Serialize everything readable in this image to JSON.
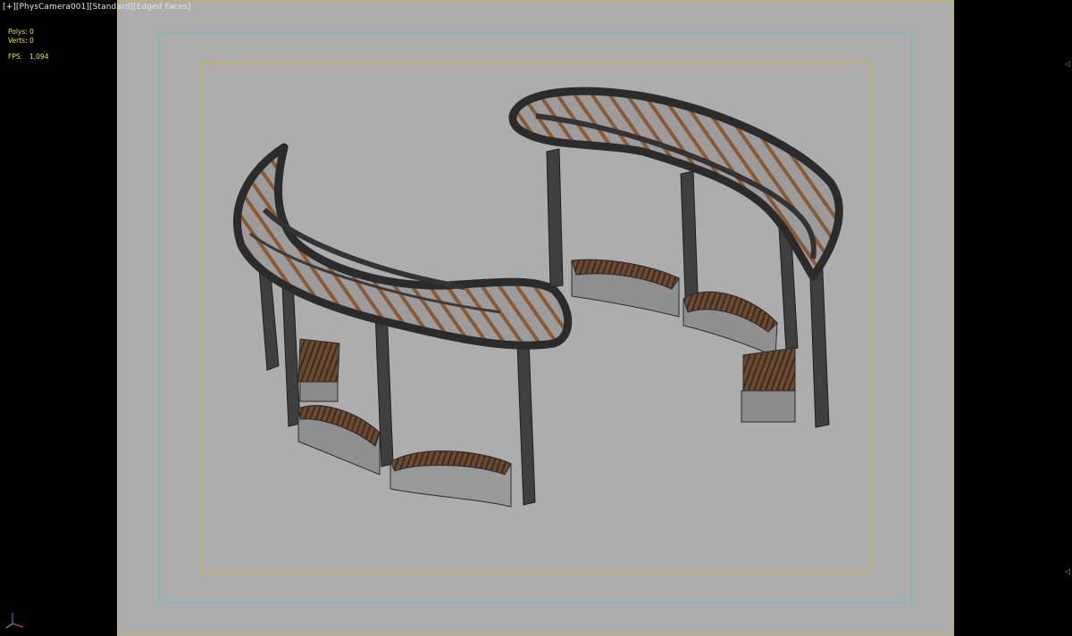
{
  "viewport": {
    "label_parts": [
      "[+]",
      "[PhysCamera001]",
      "[Standard]",
      "[Edged Faces]"
    ]
  },
  "stats": {
    "polys_label": "Polys:",
    "polys_value": "0",
    "verts_label": "Verts:",
    "verts_value": "0",
    "fps_label": "FPS:",
    "fps_value": "1,094"
  },
  "icons": {
    "axis": "axis-tripod-icon",
    "right_marker": "triangle-left-icon"
  },
  "colors": {
    "viewport_bg": "#adadad",
    "outer_bg": "#000000",
    "frame": "#c8b74a",
    "safe_frame": "#55c7d0",
    "action_safe": "#d6b12e",
    "stat_text": "#f2e34c",
    "beam": "#3b3b3b",
    "slat": "#8a5a33",
    "bench_stone": "#8c8c8c",
    "bench_wood": "#5a3d2a"
  }
}
